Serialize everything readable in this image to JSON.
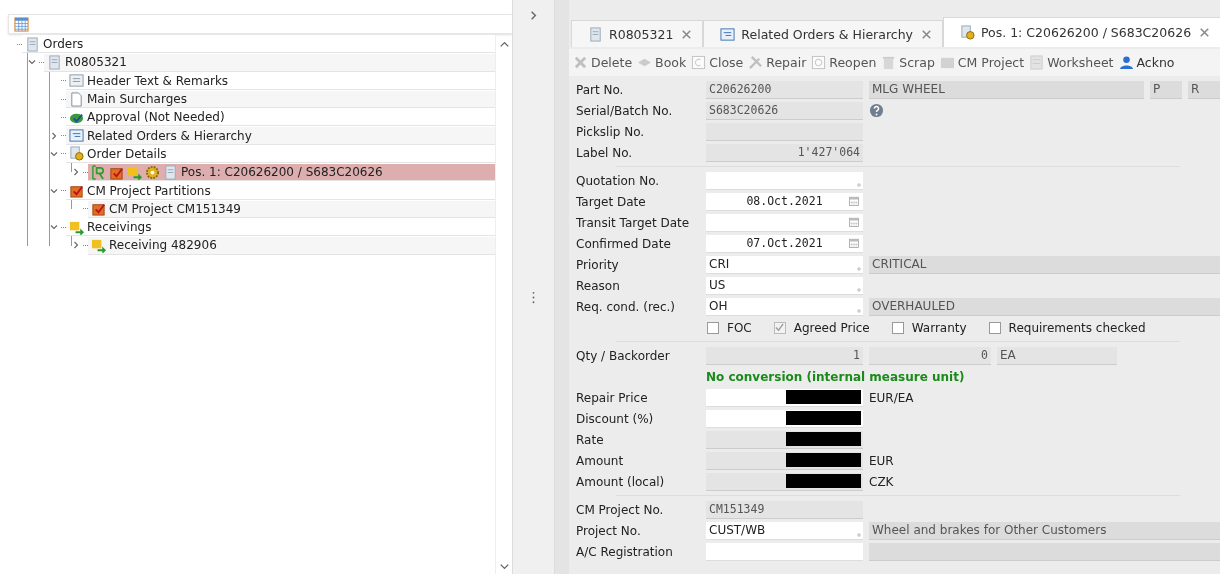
{
  "tree": {
    "nodes": [
      {
        "label": "Orders",
        "kind": "order",
        "selected": false,
        "children": [
          {
            "label": "R0805321",
            "kind": "order",
            "selected": false,
            "expanded": true,
            "children": [
              {
                "label": "Header Text & Remarks",
                "kind": "text",
                "selected": false
              },
              {
                "label": "Main Surcharges",
                "kind": "surcharge",
                "selected": false
              },
              {
                "label": "Approval (Not Needed)",
                "kind": "approval",
                "selected": false
              },
              {
                "label": "Related Orders & Hierarchy",
                "kind": "hierarchy",
                "selected": false,
                "expanded": false
              },
              {
                "label": "Order Details",
                "kind": "details",
                "selected": false,
                "expanded": true,
                "children": [
                  {
                    "label": "Pos. 1: C20626200 / S683C20626",
                    "kind": "position",
                    "selected": true,
                    "expanded": false
                  }
                ]
              },
              {
                "label": "CM Project Partitions",
                "kind": "partition",
                "selected": false,
                "expanded": true,
                "children": [
                  {
                    "label": "CM Project CM151349",
                    "kind": "partition",
                    "selected": false
                  }
                ]
              },
              {
                "label": "Receivings",
                "kind": "receiving",
                "selected": false,
                "expanded": true,
                "children": [
                  {
                    "label": "Receiving 482906",
                    "kind": "receiving",
                    "selected": false,
                    "expanded": false
                  }
                ]
              }
            ]
          }
        ]
      }
    ]
  },
  "tabs": [
    {
      "label": "R0805321",
      "kind": "order",
      "selected": false
    },
    {
      "label": "Related Orders & Hierarchy",
      "kind": "hierarchy",
      "selected": false
    },
    {
      "label": "Pos. 1: C20626200 / S683C20626",
      "kind": "details",
      "selected": true
    }
  ],
  "toolbar": [
    {
      "label": "Delete",
      "disabled": true
    },
    {
      "label": "Book",
      "disabled": true
    },
    {
      "label": "Close",
      "disabled": true
    },
    {
      "label": "Repair",
      "disabled": true
    },
    {
      "label": "Reopen",
      "disabled": true
    },
    {
      "label": "Scrap",
      "disabled": true
    },
    {
      "label": "CM Project",
      "disabled": true
    },
    {
      "label": "Worksheet",
      "disabled": true
    },
    {
      "label": "Ackno",
      "disabled": false
    }
  ],
  "form": [
    {
      "kind": "field",
      "label": "Part No.",
      "fields": [
        {
          "kind": "code",
          "value": "C20626200"
        },
        {
          "kind": "desc",
          "value": "MLG WHEEL"
        },
        {
          "kind": "tag",
          "value": "P"
        },
        {
          "kind": "tag",
          "value": "R"
        }
      ]
    },
    {
      "kind": "field",
      "label": "Serial/Batch No.",
      "fields": [
        {
          "kind": "code",
          "value": "S683C20626"
        },
        {
          "kind": "help"
        }
      ]
    },
    {
      "kind": "field",
      "label": "Pickslip No.",
      "fields": [
        {
          "kind": "code"
        }
      ]
    },
    {
      "kind": "field",
      "label": "Label No.",
      "fields": [
        {
          "kind": "number",
          "value": "1'427'064"
        }
      ]
    },
    {
      "kind": "separator"
    },
    {
      "kind": "field",
      "label": "Quotation No.",
      "fields": [
        {
          "kind": "lookup"
        }
      ]
    },
    {
      "kind": "field",
      "label": "Target Date",
      "fields": [
        {
          "kind": "date",
          "value": "08.Oct.2021"
        }
      ]
    },
    {
      "kind": "field",
      "label": "Transit Target Date",
      "fields": [
        {
          "kind": "date"
        }
      ]
    },
    {
      "kind": "field",
      "label": "Confirmed Date",
      "fields": [
        {
          "kind": "date",
          "value": "07.Oct.2021"
        }
      ]
    },
    {
      "kind": "field",
      "label": "Priority",
      "fields": [
        {
          "kind": "lookup",
          "value": "CRI"
        },
        {
          "kind": "desc",
          "value": "CRITICAL"
        }
      ]
    },
    {
      "kind": "field",
      "label": "Reason",
      "fields": [
        {
          "kind": "lookup",
          "value": "US"
        }
      ]
    },
    {
      "kind": "field",
      "label": "Req. cond. (rec.)",
      "fields": [
        {
          "kind": "lookup",
          "value": "OH"
        },
        {
          "kind": "desc",
          "value": "OVERHAULED"
        }
      ]
    },
    {
      "kind": "checkboxes",
      "items": [
        {
          "label": "FOC",
          "checked": false,
          "disabled": false
        },
        {
          "label": "Agreed Price",
          "checked": true,
          "disabled": true
        },
        {
          "label": "Warranty",
          "checked": false,
          "disabled": false
        },
        {
          "label": "Requirements checked",
          "checked": false,
          "disabled": false
        }
      ]
    },
    {
      "kind": "separator"
    },
    {
      "kind": "field",
      "label": "Qty / Backorder",
      "fields": [
        {
          "kind": "number",
          "value": "1"
        },
        {
          "kind": "count",
          "value": "0"
        },
        {
          "kind": "unit",
          "value": "EA"
        }
      ]
    },
    {
      "kind": "note",
      "text": "No conversion (internal measure unit)"
    },
    {
      "kind": "field",
      "label": "Repair Price",
      "fields": [
        {
          "kind": "redacted",
          "editable": true
        },
        {
          "kind": "suffix",
          "value": "EUR/EA"
        }
      ]
    },
    {
      "kind": "field",
      "label": "Discount (%)",
      "fields": [
        {
          "kind": "redacted",
          "editable": true
        }
      ]
    },
    {
      "kind": "field",
      "label": "Rate",
      "fields": [
        {
          "kind": "redacted",
          "editable": false
        }
      ]
    },
    {
      "kind": "field",
      "label": "Amount",
      "fields": [
        {
          "kind": "redacted",
          "editable": false
        },
        {
          "kind": "suffix",
          "value": "EUR"
        }
      ]
    },
    {
      "kind": "field",
      "label": "Amount (local)",
      "fields": [
        {
          "kind": "redacted",
          "editable": false
        },
        {
          "kind": "suffix",
          "value": "CZK"
        }
      ]
    },
    {
      "kind": "separator"
    },
    {
      "kind": "field",
      "label": "CM Project No.",
      "fields": [
        {
          "kind": "code",
          "value": "CM151349"
        }
      ]
    },
    {
      "kind": "field",
      "label": "Project No.",
      "fields": [
        {
          "kind": "lookup",
          "value": "CUST/WB"
        },
        {
          "kind": "desc",
          "value": "Wheel and brakes for Other Customers"
        }
      ]
    },
    {
      "kind": "field",
      "label": "A/C Registration",
      "fields": [
        {
          "kind": "input"
        },
        {
          "kind": "desc"
        }
      ]
    }
  ]
}
